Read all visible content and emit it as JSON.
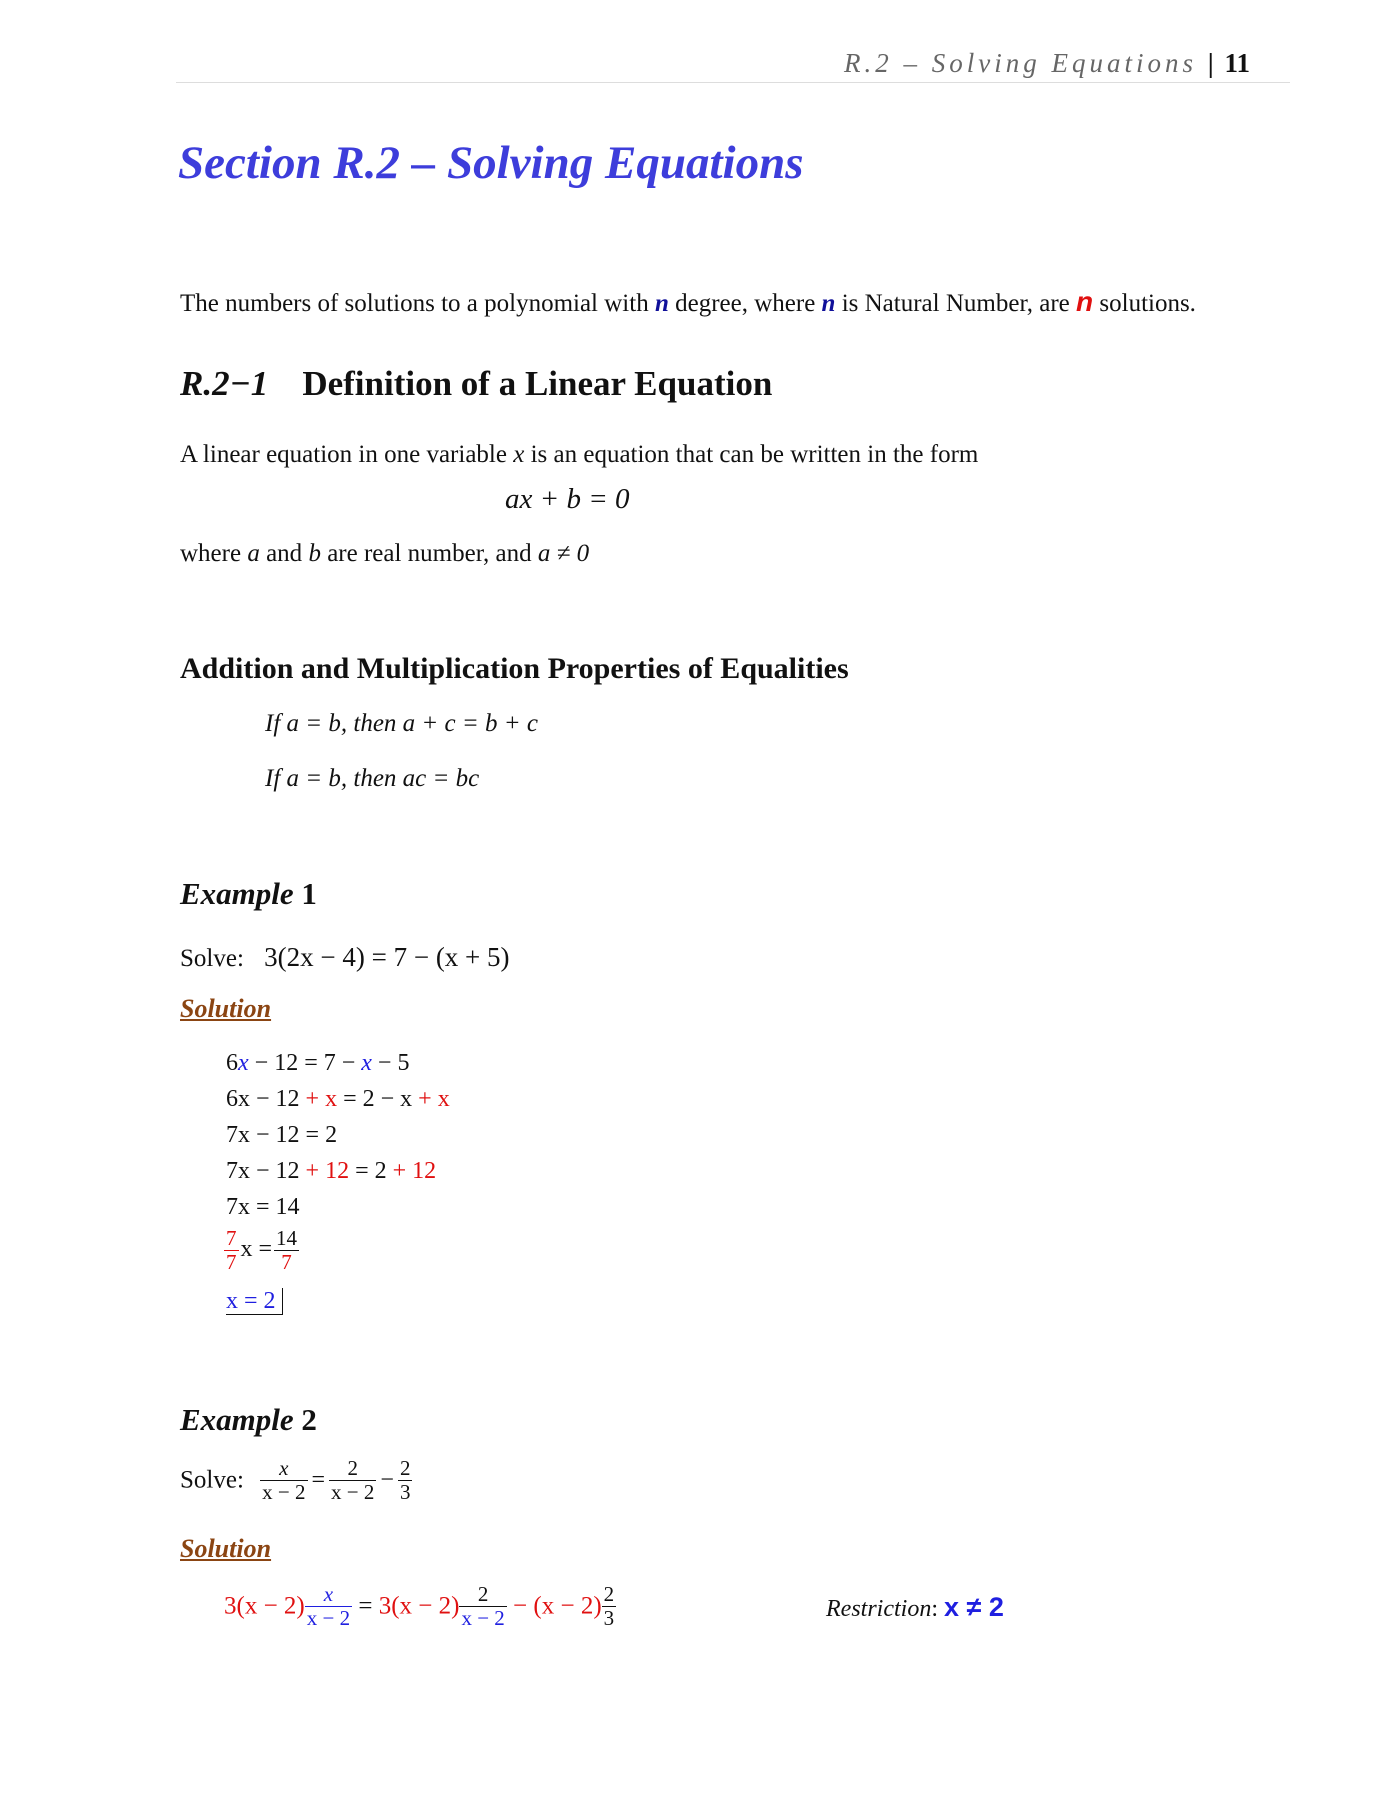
{
  "header": {
    "running_title": "R.2 – Solving Equations",
    "separator": "|",
    "page_number": "11"
  },
  "title": "Section R.2 – Solving Equations",
  "intro": {
    "before_n1": "The numbers of solutions to a polynomial with ",
    "n1": "n",
    "after_n1": " degree, where ",
    "n2": "n",
    "after_n2": " is Natural Number, are ",
    "n3": "n",
    "after_n3": " solutions."
  },
  "definition": {
    "number": "R.2−1",
    "heading": "Definition of a Linear Equation",
    "line1_before": "A linear equation in one variable ",
    "line1_var": "x",
    "line1_after": " is an equation that can be written in the form",
    "form": "ax + b = 0",
    "line2_before": "where ",
    "line2_a": "a",
    "line2_and": " and ",
    "line2_b": "b",
    "line2_after": " are real number, and ",
    "line2_cond": "a ≠ 0"
  },
  "properties": {
    "heading": "Addition and Multiplication Properties of Equalities",
    "rule1": "If  a = b,  then  a + c = b + c",
    "rule2": "If  a = b,  then  ac = bc"
  },
  "example1": {
    "label_italic": "Example",
    "label_number": "1",
    "solve_label": "Solve:",
    "equation": "3(2x − 4)  =  7 − (x + 5)",
    "solution_label": "Solution",
    "steps": {
      "s1a": "6",
      "s1b": "x",
      "s1c": " − 12 = 7 − ",
      "s1d": "x",
      "s1e": " − 5",
      "s2a": "6x − 12",
      "s2b": " + x",
      "s2c": " = 2 − x",
      "s2d": " + x",
      "s3": "7x − 12 = 2",
      "s4a": "7x − 12",
      "s4b": " + 12",
      "s4c": " = 2",
      "s4d": " + 12",
      "s5": "7x = 14",
      "s6_num1": "7",
      "s6_den1": "7",
      "s6_mid": "x =",
      "s6_num2": "14",
      "s6_den2": "7",
      "answer": "x = 2"
    }
  },
  "example2": {
    "label_italic": "Example",
    "label_number": "2",
    "solve_label": "Solve:",
    "lhs_num": "x",
    "lhs_den": "x − 2",
    "eq": "=",
    "rhs1_num": "2",
    "rhs1_den": "x − 2",
    "minus": "−",
    "rhs2_num": "2",
    "rhs2_den": "3",
    "solution_label": "Solution",
    "work": {
      "p1": "3(x − 2)",
      "f1_num": "x",
      "f1_den": "x − 2",
      "eq": " = ",
      "p2": "3(x − 2)",
      "f2_num": "2",
      "f2_den": "x − 2",
      "p3": " − (x − 2)",
      "f3_num": "2",
      "f3_den": "3"
    },
    "restriction_label": "Restriction",
    "restriction_colon": ":",
    "restriction_value": "x ≠ 2"
  }
}
